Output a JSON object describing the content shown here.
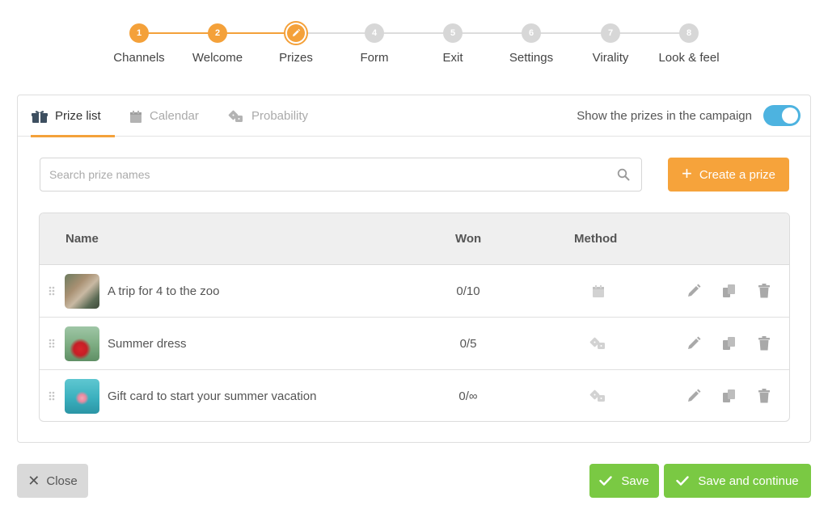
{
  "stepper": {
    "steps": [
      {
        "num": "1",
        "label": "Channels",
        "state": "done"
      },
      {
        "num": "2",
        "label": "Welcome",
        "state": "done"
      },
      {
        "num": "3",
        "label": "Prizes",
        "state": "current"
      },
      {
        "num": "4",
        "label": "Form",
        "state": "todo"
      },
      {
        "num": "5",
        "label": "Exit",
        "state": "todo"
      },
      {
        "num": "6",
        "label": "Settings",
        "state": "todo"
      },
      {
        "num": "7",
        "label": "Virality",
        "state": "todo"
      },
      {
        "num": "8",
        "label": "Look & feel",
        "state": "todo"
      }
    ]
  },
  "tabs": {
    "prize_list": {
      "label": "Prize list",
      "icon": "gift-icon"
    },
    "calendar": {
      "label": "Calendar",
      "icon": "calendar-icon"
    },
    "probability": {
      "label": "Probability",
      "icon": "dice-icon"
    }
  },
  "show_prizes": {
    "label": "Show the prizes in the campaign",
    "enabled": true
  },
  "search": {
    "placeholder": "Search prize names",
    "value": ""
  },
  "create_button": {
    "label": "Create a prize"
  },
  "table": {
    "headers": {
      "name": "Name",
      "won": "Won",
      "method": "Method"
    },
    "rows": [
      {
        "name": "A trip for 4 to the zoo",
        "won": "0/10",
        "method": "calendar-icon"
      },
      {
        "name": "Summer dress",
        "won": "0/5",
        "method": "dice-icon"
      },
      {
        "name": "Gift card to start your summer vacation",
        "won": "0/∞",
        "method": "dice-icon"
      }
    ]
  },
  "footer": {
    "close_label": "Close",
    "save_label": "Save",
    "save_continue_label": "Save and continue"
  },
  "colors": {
    "accent": "#f4a13a",
    "toggle": "#4db3e0",
    "success": "#7ac943",
    "neutral_button": "#d9d9d9"
  }
}
